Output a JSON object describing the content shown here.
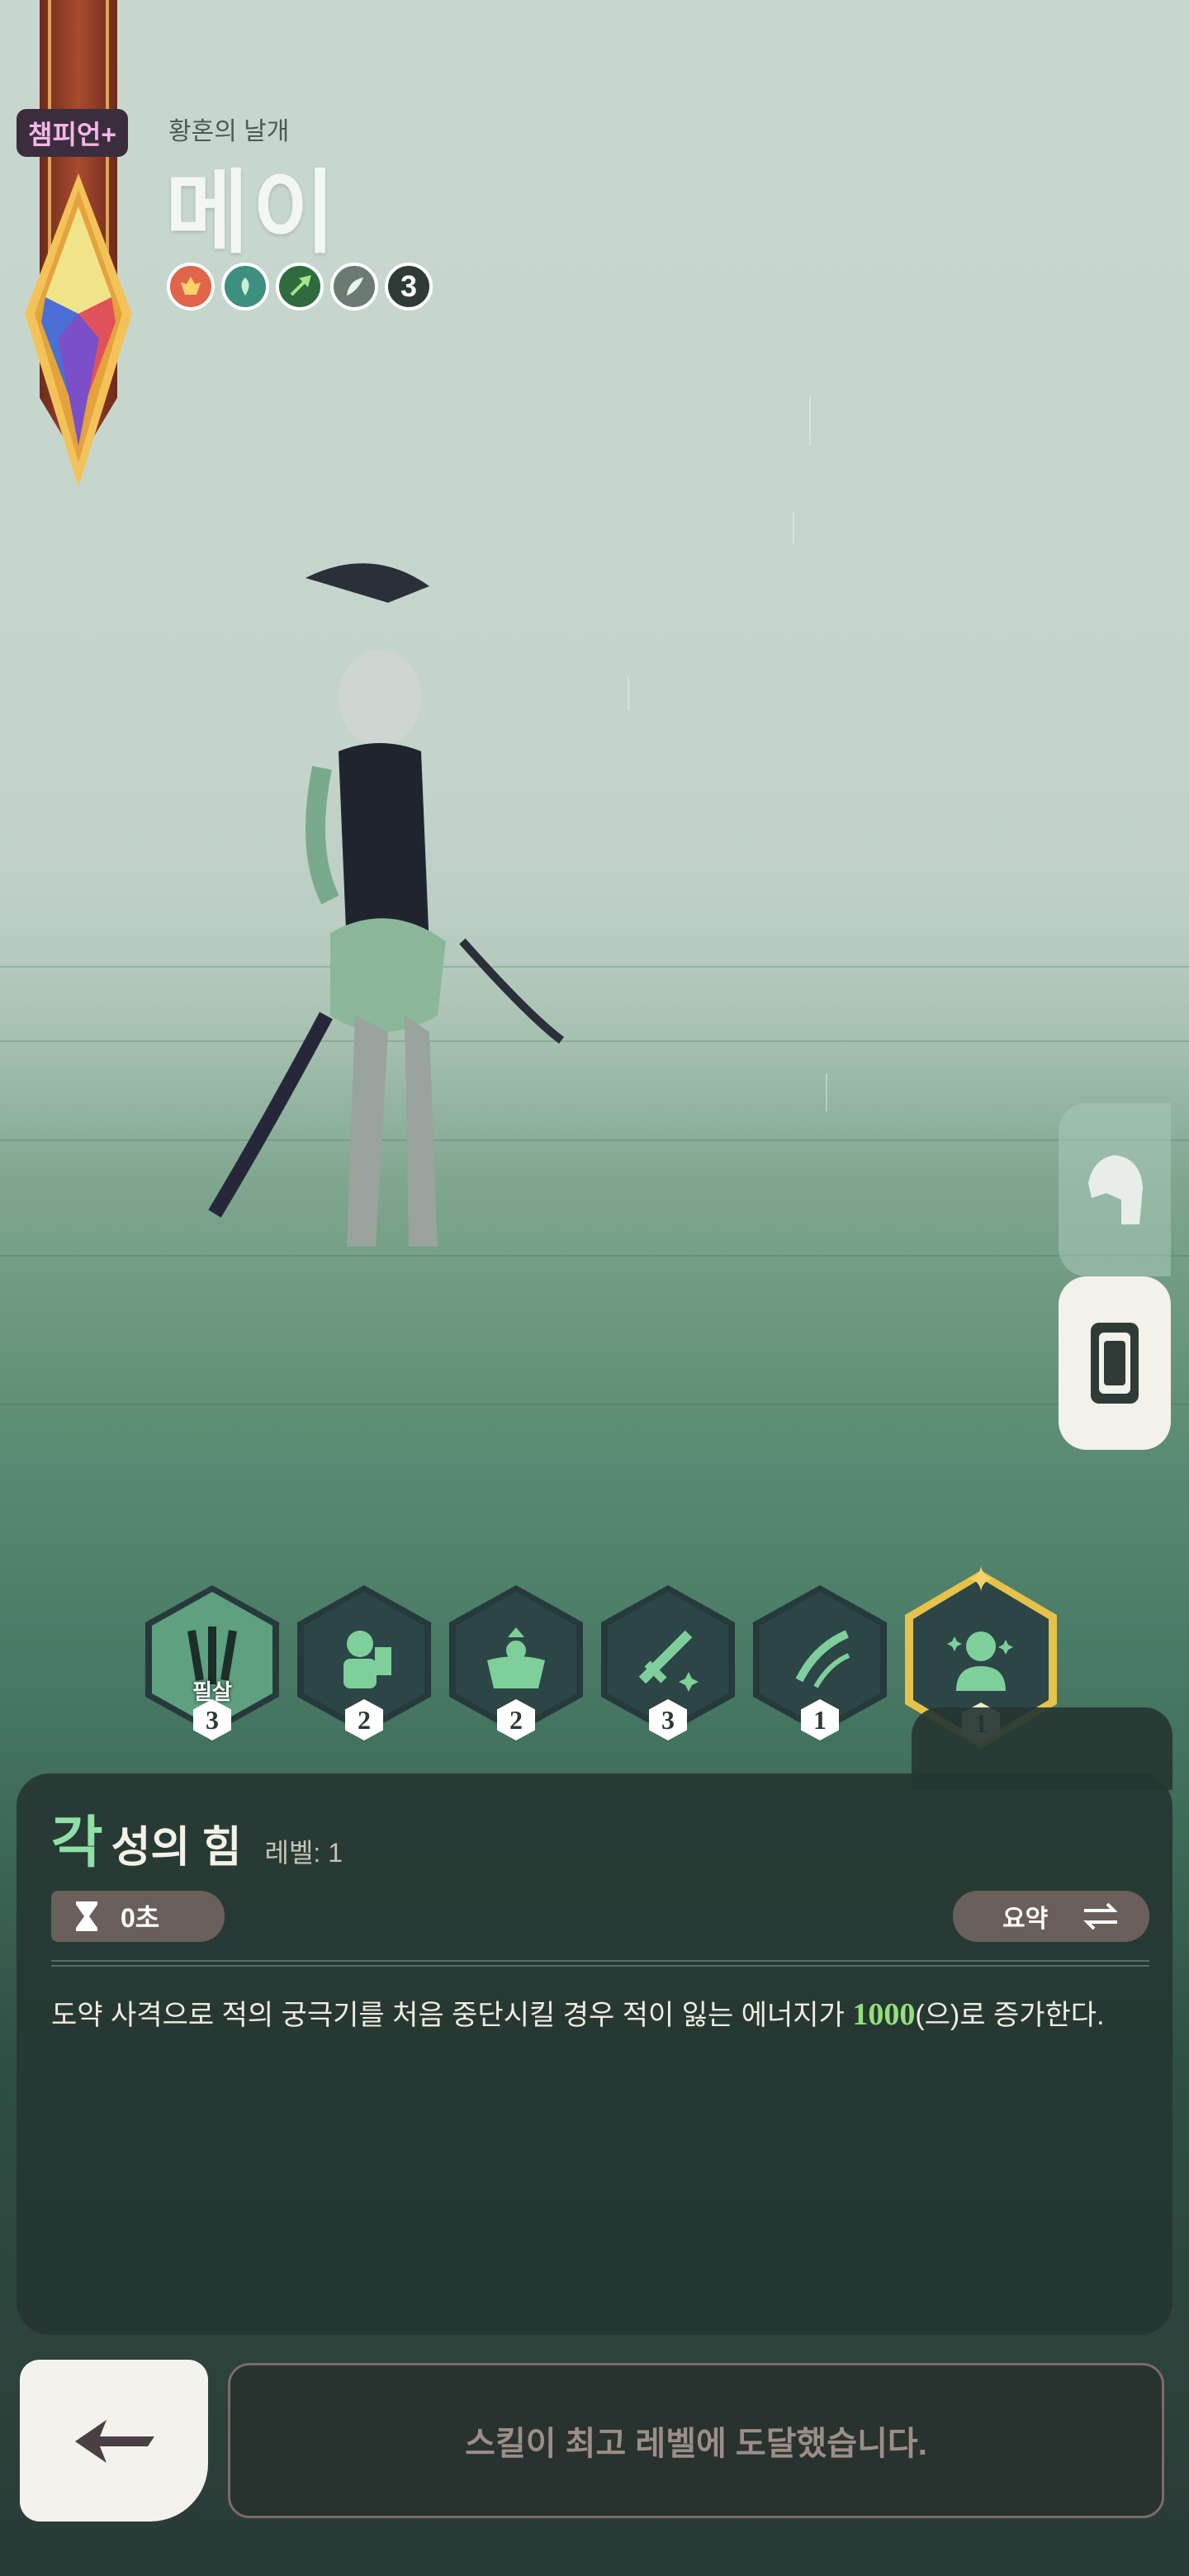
{
  "header": {
    "rank_tag": "챔피언+",
    "subtitle": "황혼의 날개",
    "name": "메이",
    "trait_icons": [
      "fire-crest-icon",
      "nature-icon",
      "spear-icon",
      "feather-icon"
    ],
    "trait_count": "3"
  },
  "side_buttons": [
    "profile-helmet-icon",
    "scroll-icon"
  ],
  "skills": [
    {
      "icon": "claw-icon",
      "level": "3",
      "tag": "필살"
    },
    {
      "icon": "knight-shield-icon",
      "level": "2"
    },
    {
      "icon": "muscle-warrior-icon",
      "level": "2"
    },
    {
      "icon": "sword-icon",
      "level": "3"
    },
    {
      "icon": "arrow-slash-icon",
      "level": "1"
    },
    {
      "icon": "awakened-knight-icon",
      "level": "1",
      "selected": true
    }
  ],
  "detail": {
    "title_first": "각",
    "title_rest": "성의 힘",
    "level_label": "레벨: 1",
    "cooldown": "0초",
    "summary_label": "요약",
    "description_before": "도약 사격으로 적의 궁극기를 처음 중단시킬 경우 적이 잃는 에너지가 ",
    "description_value": "1000",
    "description_after": "(으)로 증가한다."
  },
  "footer": {
    "status_message": "스킬이 최고 레벨에 도달했습니다."
  },
  "colors": {
    "accent_green": "#93e07a",
    "selected_gold": "#e6c24a",
    "panel_bg": "#263632"
  }
}
